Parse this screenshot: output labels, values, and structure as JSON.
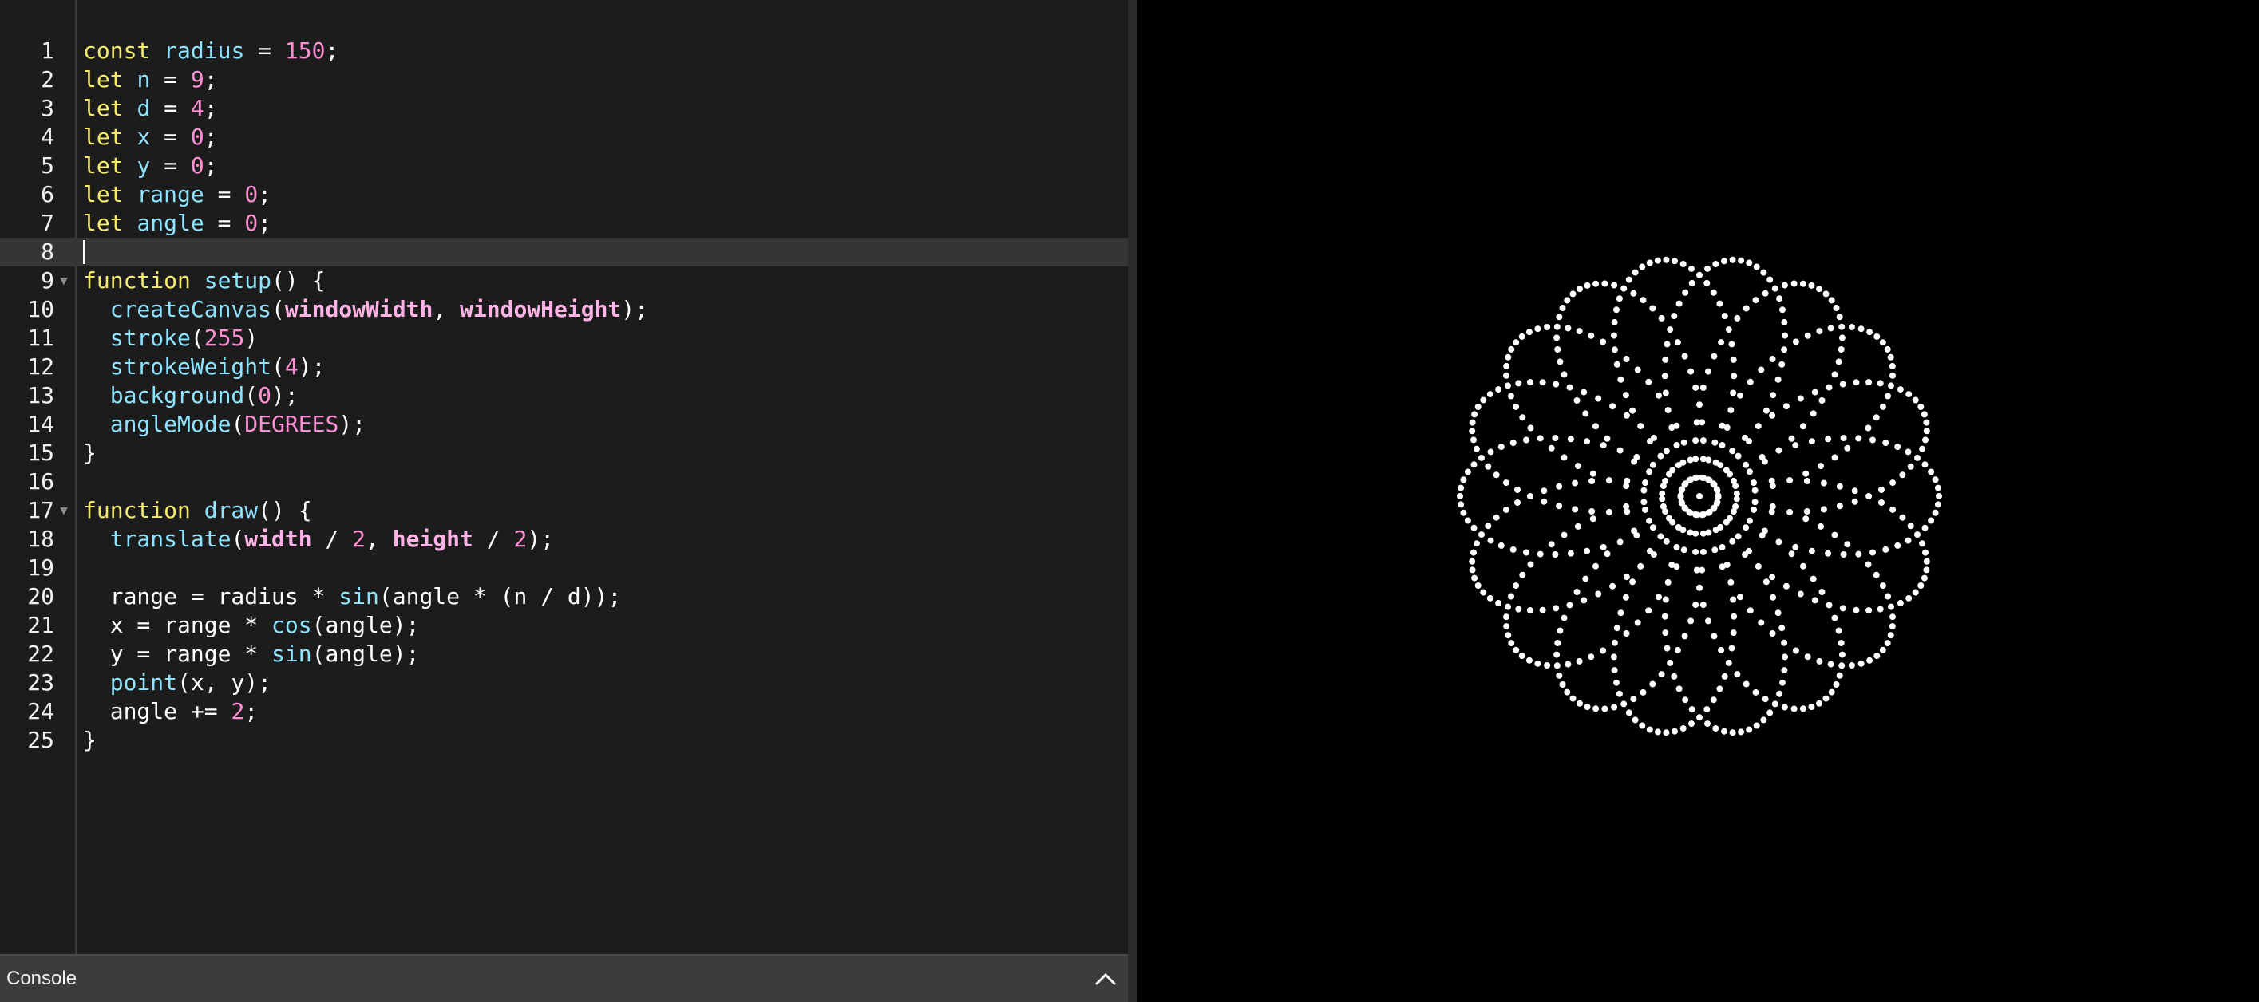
{
  "editor": {
    "lines": [
      {
        "num": "1",
        "tokens": [
          [
            "keyword",
            "const"
          ],
          [
            "plain",
            " "
          ],
          [
            "ident",
            "radius"
          ],
          [
            "plain",
            " = "
          ],
          [
            "num",
            "150"
          ],
          [
            "plain",
            ";"
          ]
        ]
      },
      {
        "num": "2",
        "tokens": [
          [
            "keyword",
            "let"
          ],
          [
            "plain",
            " "
          ],
          [
            "ident",
            "n"
          ],
          [
            "plain",
            " = "
          ],
          [
            "num",
            "9"
          ],
          [
            "plain",
            ";"
          ]
        ]
      },
      {
        "num": "3",
        "tokens": [
          [
            "keyword",
            "let"
          ],
          [
            "plain",
            " "
          ],
          [
            "ident",
            "d"
          ],
          [
            "plain",
            " = "
          ],
          [
            "num",
            "4"
          ],
          [
            "plain",
            ";"
          ]
        ]
      },
      {
        "num": "4",
        "tokens": [
          [
            "keyword",
            "let"
          ],
          [
            "plain",
            " "
          ],
          [
            "ident",
            "x"
          ],
          [
            "plain",
            " = "
          ],
          [
            "num",
            "0"
          ],
          [
            "plain",
            ";"
          ]
        ]
      },
      {
        "num": "5",
        "tokens": [
          [
            "keyword",
            "let"
          ],
          [
            "plain",
            " "
          ],
          [
            "ident",
            "y"
          ],
          [
            "plain",
            " = "
          ],
          [
            "num",
            "0"
          ],
          [
            "plain",
            ";"
          ]
        ]
      },
      {
        "num": "6",
        "tokens": [
          [
            "keyword",
            "let"
          ],
          [
            "plain",
            " "
          ],
          [
            "ident",
            "range"
          ],
          [
            "plain",
            " = "
          ],
          [
            "num",
            "0"
          ],
          [
            "plain",
            ";"
          ]
        ]
      },
      {
        "num": "7",
        "tokens": [
          [
            "keyword",
            "let"
          ],
          [
            "plain",
            " "
          ],
          [
            "ident",
            "angle"
          ],
          [
            "plain",
            " = "
          ],
          [
            "num",
            "0"
          ],
          [
            "plain",
            ";"
          ]
        ]
      },
      {
        "num": "8",
        "tokens": [],
        "active": true
      },
      {
        "num": "9",
        "fold": true,
        "tokens": [
          [
            "keyword",
            "function"
          ],
          [
            "plain",
            " "
          ],
          [
            "func",
            "setup"
          ],
          [
            "plain",
            "() {"
          ]
        ]
      },
      {
        "num": "10",
        "tokens": [
          [
            "plain",
            "  "
          ],
          [
            "func",
            "createCanvas"
          ],
          [
            "plain",
            "("
          ],
          [
            "param",
            "windowWidth"
          ],
          [
            "plain",
            ", "
          ],
          [
            "param",
            "windowHeight"
          ],
          [
            "plain",
            ");"
          ]
        ]
      },
      {
        "num": "11",
        "tokens": [
          [
            "plain",
            "  "
          ],
          [
            "func",
            "stroke"
          ],
          [
            "plain",
            "("
          ],
          [
            "num",
            "255"
          ],
          [
            "plain",
            ")"
          ]
        ]
      },
      {
        "num": "12",
        "tokens": [
          [
            "plain",
            "  "
          ],
          [
            "func",
            "strokeWeight"
          ],
          [
            "plain",
            "("
          ],
          [
            "num",
            "4"
          ],
          [
            "plain",
            ");"
          ]
        ]
      },
      {
        "num": "13",
        "tokens": [
          [
            "plain",
            "  "
          ],
          [
            "func",
            "background"
          ],
          [
            "plain",
            "("
          ],
          [
            "num",
            "0"
          ],
          [
            "plain",
            ");"
          ]
        ]
      },
      {
        "num": "14",
        "tokens": [
          [
            "plain",
            "  "
          ],
          [
            "func",
            "angleMode"
          ],
          [
            "plain",
            "("
          ],
          [
            "const",
            "DEGREES"
          ],
          [
            "plain",
            ");"
          ]
        ]
      },
      {
        "num": "15",
        "tokens": [
          [
            "plain",
            "}"
          ]
        ]
      },
      {
        "num": "16",
        "tokens": []
      },
      {
        "num": "17",
        "fold": true,
        "tokens": [
          [
            "keyword",
            "function"
          ],
          [
            "plain",
            " "
          ],
          [
            "func",
            "draw"
          ],
          [
            "plain",
            "() {"
          ]
        ]
      },
      {
        "num": "18",
        "tokens": [
          [
            "plain",
            "  "
          ],
          [
            "func",
            "translate"
          ],
          [
            "plain",
            "("
          ],
          [
            "param",
            "width"
          ],
          [
            "plain",
            " / "
          ],
          [
            "num",
            "2"
          ],
          [
            "plain",
            ", "
          ],
          [
            "param",
            "height"
          ],
          [
            "plain",
            " / "
          ],
          [
            "num",
            "2"
          ],
          [
            "plain",
            ");"
          ]
        ]
      },
      {
        "num": "19",
        "tokens": []
      },
      {
        "num": "20",
        "tokens": [
          [
            "plain",
            "  range = radius * "
          ],
          [
            "func",
            "sin"
          ],
          [
            "plain",
            "(angle * (n / d));"
          ]
        ]
      },
      {
        "num": "21",
        "tokens": [
          [
            "plain",
            "  x = range * "
          ],
          [
            "func",
            "cos"
          ],
          [
            "plain",
            "(angle);"
          ]
        ]
      },
      {
        "num": "22",
        "tokens": [
          [
            "plain",
            "  y = range * "
          ],
          [
            "func",
            "sin"
          ],
          [
            "plain",
            "(angle);"
          ]
        ]
      },
      {
        "num": "23",
        "tokens": [
          [
            "plain",
            "  "
          ],
          [
            "func",
            "point"
          ],
          [
            "plain",
            "(x, y);"
          ]
        ]
      },
      {
        "num": "24",
        "tokens": [
          [
            "plain",
            "  angle += "
          ],
          [
            "num",
            "2"
          ],
          [
            "plain",
            ";"
          ]
        ]
      },
      {
        "num": "25",
        "tokens": [
          [
            "plain",
            "}"
          ]
        ]
      }
    ]
  },
  "console": {
    "label": "Console",
    "toggle_icon": "chevron-up-icon"
  },
  "preview": {
    "background": "#000000",
    "point_color": "#ffffff",
    "radius": 150,
    "n": 9,
    "d": 4,
    "angle_step": 2
  },
  "colors": {
    "editor_bg": "#1c1c1c",
    "keyword": "#f5ea6b",
    "identifier": "#8ee3ff",
    "number": "#ff8fd5"
  }
}
